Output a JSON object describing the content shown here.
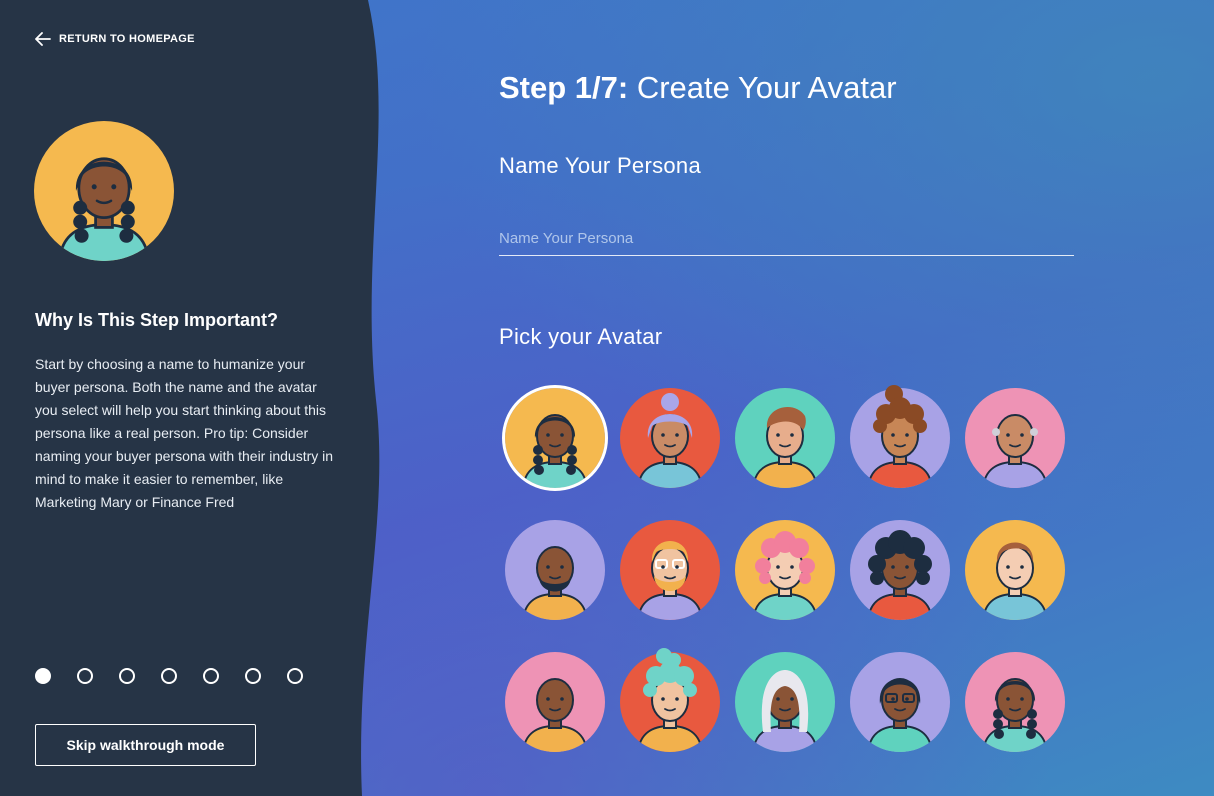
{
  "nav": {
    "back_label": "RETURN TO HOMEPAGE"
  },
  "sidebar": {
    "heading": "Why Is This Step Important?",
    "body": "Start by choosing a name to humanize your buyer persona. Both the name and the avatar you select will help you start thinking about this persona like a real person. Pro tip: Consider naming your buyer persona with their industry in mind to make it easier to remember, like Marketing Mary or Finance Fred",
    "progress": {
      "total_steps": 7,
      "current_step": 1
    },
    "skip_label": "Skip walkthrough mode",
    "background_color": "#263446"
  },
  "main": {
    "step_prefix": "Step 1/7:",
    "step_title": "Create Your Avatar",
    "name_label": "Name Your Persona",
    "name_input": {
      "value": "",
      "placeholder": "Name Your Persona"
    },
    "pick_label": "Pick your Avatar",
    "selected_avatar": 0,
    "avatars": [
      {
        "id": "avatar-1",
        "bg": "#f5b94f",
        "skin": "#8a5436",
        "hair": "#1d2d40",
        "shirt": "#6fd3c8",
        "style": "braids"
      },
      {
        "id": "avatar-2",
        "bg": "#e8593f",
        "skin": "#c98b66",
        "hair": "#a9a6ea",
        "shirt": "#78c5d8",
        "style": "bun-gray"
      },
      {
        "id": "avatar-3",
        "bg": "#5fd2be",
        "skin": "#e7ad8c",
        "hair": "#a6603c",
        "shirt": "#f2b14d",
        "style": "quiff"
      },
      {
        "id": "avatar-4",
        "bg": "#a8a2e6",
        "skin": "#c78656",
        "hair": "#8a4a25",
        "shirt": "#e8593f",
        "style": "curly-bun"
      },
      {
        "id": "avatar-5",
        "bg": "#ee93b5",
        "skin": "#c98b66",
        "hair": "#cfcfd8",
        "shirt": "#a8a2e6",
        "style": "bald-gray"
      },
      {
        "id": "avatar-6",
        "bg": "#a8a2e6",
        "skin": "#8a5436",
        "hair": "#1d2d40",
        "shirt": "#f2b14d",
        "style": "beard"
      },
      {
        "id": "avatar-7",
        "bg": "#e8593f",
        "skin": "#f0c3a0",
        "hair": "#f2b14d",
        "shirt": "#a8a2e6",
        "style": "glasses-beard"
      },
      {
        "id": "avatar-8",
        "bg": "#f5b94f",
        "skin": "#f4cdb3",
        "hair": "#f27f9c",
        "shirt": "#6fd3c8",
        "style": "curly-pink"
      },
      {
        "id": "avatar-9",
        "bg": "#a8a2e6",
        "skin": "#8a5436",
        "hair": "#1d2d40",
        "shirt": "#e8593f",
        "style": "afro"
      },
      {
        "id": "avatar-10",
        "bg": "#f5b94f",
        "skin": "#f4cdb3",
        "hair": "#a6603c",
        "shirt": "#78c5d8",
        "style": "short"
      },
      {
        "id": "avatar-11",
        "bg": "#ee93b5",
        "skin": "#8a5436",
        "hair": "#6e3e28",
        "shirt": "#f2b14d",
        "style": "bald"
      },
      {
        "id": "avatar-12",
        "bg": "#e8593f",
        "skin": "#f0c3a0",
        "hair": "#6fd3c8",
        "shirt": "#f2b14d",
        "style": "curly-teal"
      },
      {
        "id": "avatar-13",
        "bg": "#5fd2be",
        "skin": "#8a5436",
        "hair": "#e8e8ee",
        "shirt": "#a8a2e6",
        "style": "long-gray"
      },
      {
        "id": "avatar-14",
        "bg": "#a8a2e6",
        "skin": "#8a5436",
        "hair": "#1d2d40",
        "shirt": "#5fd2be",
        "style": "glasses"
      },
      {
        "id": "avatar-15",
        "bg": "#ee93b5",
        "skin": "#8a5436",
        "hair": "#1d2d40",
        "shirt": "#6fd3c8",
        "style": "braids"
      }
    ]
  }
}
